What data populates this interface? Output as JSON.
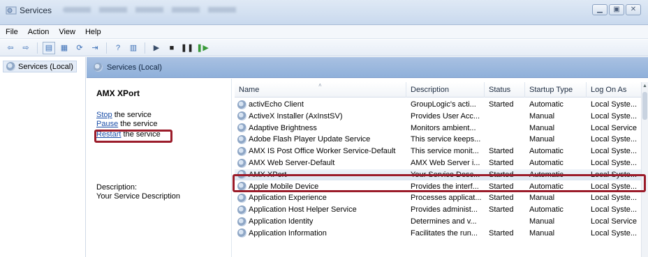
{
  "window": {
    "title": "Services"
  },
  "menubar": {
    "items": [
      "File",
      "Action",
      "View",
      "Help"
    ]
  },
  "tree": {
    "item_label": "Services (Local)"
  },
  "main_header": {
    "label": "Services (Local)"
  },
  "detail": {
    "service_name": "AMX XPort",
    "stop_link": "Stop",
    "stop_rest": " the service",
    "pause_link": "Pause",
    "pause_rest": " the service",
    "restart_link": "Restart",
    "restart_rest": " the service",
    "description_label": "Description:",
    "description_text": "Your Service Description"
  },
  "columns": [
    "Name",
    "Description",
    "Status",
    "Startup Type",
    "Log On As"
  ],
  "rows": [
    {
      "name": "activEcho Client",
      "description": "GroupLogic's acti...",
      "status": "Started",
      "startup": "Automatic",
      "logon": "Local Syste..."
    },
    {
      "name": "ActiveX Installer (AxInstSV)",
      "description": "Provides User Acc...",
      "status": "",
      "startup": "Manual",
      "logon": "Local Syste..."
    },
    {
      "name": "Adaptive Brightness",
      "description": "Monitors ambient...",
      "status": "",
      "startup": "Manual",
      "logon": "Local Service"
    },
    {
      "name": "Adobe Flash Player Update Service",
      "description": "This service keeps...",
      "status": "",
      "startup": "Manual",
      "logon": "Local Syste..."
    },
    {
      "name": "AMX IS Post Office Worker Service-Default",
      "description": "This service monit...",
      "status": "Started",
      "startup": "Automatic",
      "logon": "Local Syste..."
    },
    {
      "name": "AMX Web Server-Default",
      "description": "AMX Web Server i...",
      "status": "Started",
      "startup": "Automatic",
      "logon": "Local Syste..."
    },
    {
      "name": "AMX XPort",
      "description": "Your Service Desc...",
      "status": "Started",
      "startup": "Automatic",
      "logon": "Local Syste..."
    },
    {
      "name": "Apple Mobile Device",
      "description": "Provides the interf...",
      "status": "Started",
      "startup": "Automatic",
      "logon": "Local Syste..."
    },
    {
      "name": "Application Experience",
      "description": "Processes applicat...",
      "status": "Started",
      "startup": "Manual",
      "logon": "Local Syste..."
    },
    {
      "name": "Application Host Helper Service",
      "description": "Provides administ...",
      "status": "Started",
      "startup": "Automatic",
      "logon": "Local Syste..."
    },
    {
      "name": "Application Identity",
      "description": "Determines and v...",
      "status": "",
      "startup": "Manual",
      "logon": "Local Service"
    },
    {
      "name": "Application Information",
      "description": "Facilitates the run...",
      "status": "Started",
      "startup": "Manual",
      "logon": "Local Syste..."
    }
  ],
  "icons": {
    "app": "services-icon",
    "row": "gear-icon",
    "toolbar": [
      "back-icon",
      "forward-icon",
      "console-tree-icon",
      "properties-icon",
      "refresh-icon",
      "export-icon",
      "help-icon",
      "view-icon",
      "play-icon",
      "stop-icon",
      "pause-icon",
      "resume-icon"
    ]
  },
  "colors": {
    "highlight_border": "#9b1c2a",
    "link": "#1b4ea8",
    "header_blue": "#8fb0da"
  }
}
